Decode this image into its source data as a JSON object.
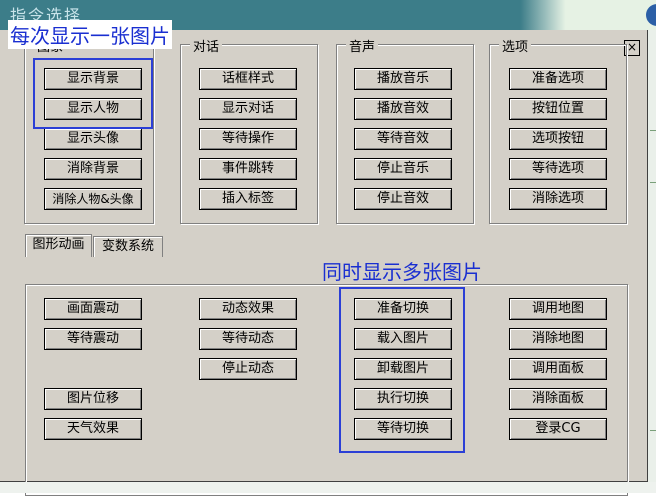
{
  "window": {
    "title": "指令选择",
    "close_glyph": "×"
  },
  "annotations": {
    "single_image": "每次显示一张图片",
    "multi_image": "同时显示多张图片"
  },
  "groups": {
    "image": {
      "label": "图象",
      "buttons": [
        "显示背景",
        "显示人物",
        "显示头像",
        "消除背景",
        "消除人物&头像"
      ]
    },
    "dialogue": {
      "label": "对话",
      "buttons": [
        "话框样式",
        "显示对话",
        "等待操作",
        "事件跳转",
        "插入标签"
      ]
    },
    "sound": {
      "label": "音声",
      "buttons": [
        "播放音乐",
        "播放音效",
        "等待音效",
        "停止音乐",
        "停止音效"
      ]
    },
    "options": {
      "label": "选项",
      "buttons": [
        "准备选项",
        "按钮位置",
        "选项按钮",
        "等待选项",
        "消除选项"
      ]
    }
  },
  "tabs": [
    {
      "label": "图形动画",
      "active": true
    },
    {
      "label": "变数系统",
      "active": false
    }
  ],
  "animation": {
    "col1": [
      "画面震动",
      "等待震动",
      "图片位移",
      "天气效果"
    ],
    "col2": [
      "动态效果",
      "等待动态",
      "停止动态"
    ],
    "col3": [
      "准备切换",
      "载入图片",
      "卸载图片",
      "执行切换",
      "等待切换"
    ],
    "col4": [
      "调用地图",
      "消除地图",
      "调用面板",
      "消除面板",
      "登录CG"
    ]
  },
  "colors": {
    "title_bar": "#3c7d89",
    "dialog_face": "#d4d0c8",
    "annotation_blue": "#1a2fd1"
  }
}
